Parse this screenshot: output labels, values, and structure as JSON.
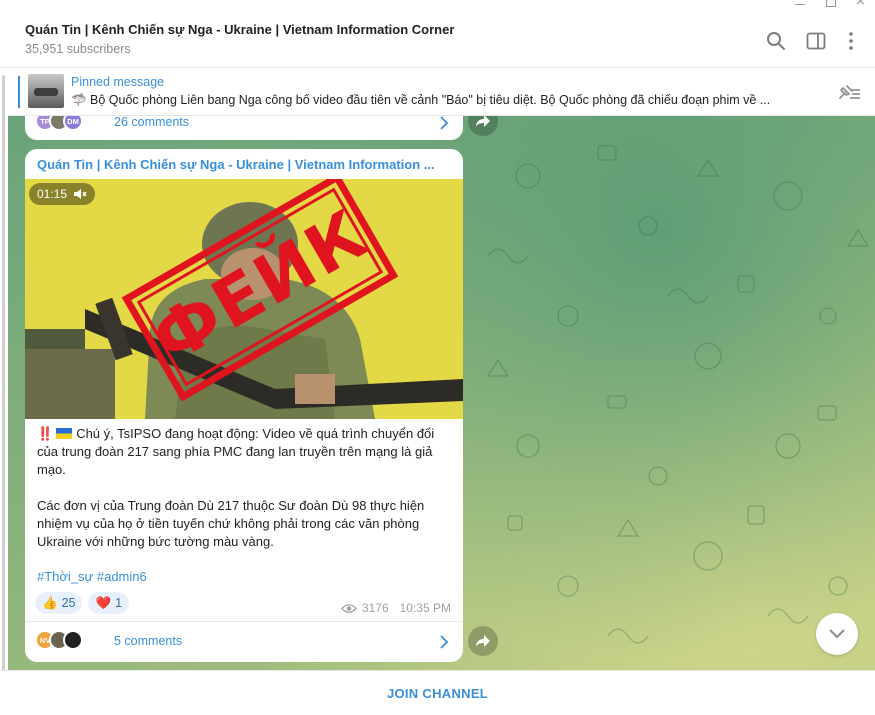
{
  "header": {
    "title": "Quán Tin | Kênh Chiến sự Nga - Ukraine | Vietnam Information Corner",
    "subscribers": "35,951 subscribers"
  },
  "pinned": {
    "label": "Pinned message",
    "text": "🦈 Bộ Quốc phòng Liên bang Nga công bố video đầu tiên về cảnh \"Báo\" bị tiêu diệt.  Bộ Quốc phòng đã chiếu đoạn phim về ..."
  },
  "prev_message": {
    "avatars": [
      "TP",
      "",
      "DM"
    ],
    "comments": "26 comments"
  },
  "message": {
    "sender": "Quán Tin | Kênh Chiến sự Nga - Ukraine | Vietnam Information ...",
    "video_duration": "01:15",
    "stamp_text": "ФЕЙК",
    "bangs": "‼️",
    "paragraph1": "Chú ý, TsIPSO đang hoạt động: Video về quá trình chuyển đổi của trung đoàn 217 sang phía PMC đang lan truyền trên mạng là giả mạo.",
    "paragraph2": " Các đơn vị của Trung đoàn Dù 217 thuộc Sư đoàn Dù 98 thực hiện nhiệm vụ của họ ở tiền tuyến chứ không phải trong các văn phòng Ukraine với những bức tường màu vàng.",
    "hashtags": "#Thời_sự #admin6",
    "reactions": [
      {
        "emoji": "👍",
        "count": "25"
      },
      {
        "emoji": "❤️",
        "count": "1"
      }
    ],
    "views": "3176",
    "time": "10:35 PM",
    "avatars": [
      "NV",
      "",
      ""
    ],
    "comments": "5 comments"
  },
  "footer": {
    "join_label": "JOIN CHANNEL"
  },
  "colors": {
    "accent": "#3a8fd9",
    "stamp_red": "#e0141e",
    "video_bg": "#e3d947"
  },
  "icons": [
    "search-icon",
    "sidebar-toggle-icon",
    "more-vertical-icon",
    "unpin-icon",
    "mute-icon",
    "chevron-right-icon",
    "forward-icon",
    "eye-icon",
    "chevron-down-icon"
  ]
}
